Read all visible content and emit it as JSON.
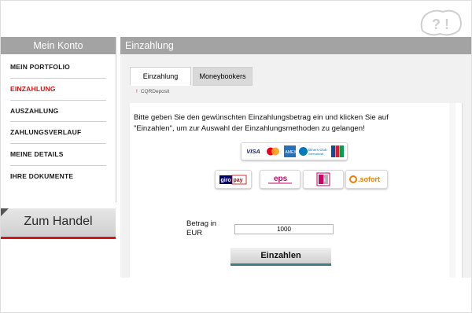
{
  "sidebar": {
    "title": "Mein Konto",
    "items": [
      {
        "label": "MEIN PORTFOLIO"
      },
      {
        "label": "EINZAHLUNG"
      },
      {
        "label": "AUSZAHLUNG"
      },
      {
        "label": "ZAHLUNGSVERLAUF"
      },
      {
        "label": "MEINE DETAILS"
      },
      {
        "label": "IHRE DOKUMENTE"
      }
    ],
    "active_item": "EINZAHLUNG",
    "trade_button": "Zum Handel"
  },
  "main": {
    "title": "Einzahlung",
    "tabs": [
      {
        "label": "Einzahlung",
        "active": true
      },
      {
        "label": "Moneybookers",
        "active": false
      }
    ],
    "sub_label": "CQRDeposit",
    "instructions": "Bitte geben Sie den gewünschten Einzahlungsbetrag ein und klicken Sie auf \"Einzahlen\", um zur Auswahl der Einzahlungsmethoden zu gelangen!",
    "payment_methods": {
      "cards": [
        "VISA",
        "Mastercard",
        "American Express",
        "Diners Club",
        "JCB"
      ],
      "giropay": "giropay",
      "eps": "eps",
      "ideal": "iDEAL",
      "sofort": "sofort"
    },
    "amount_label": "Betrag in EUR",
    "amount_value": "1000",
    "submit_button": "Einzahlen"
  },
  "colors": {
    "header_gray": "#a3a3a3",
    "accent_red": "#cc1a1a",
    "button_teal": "#3d7f86"
  }
}
